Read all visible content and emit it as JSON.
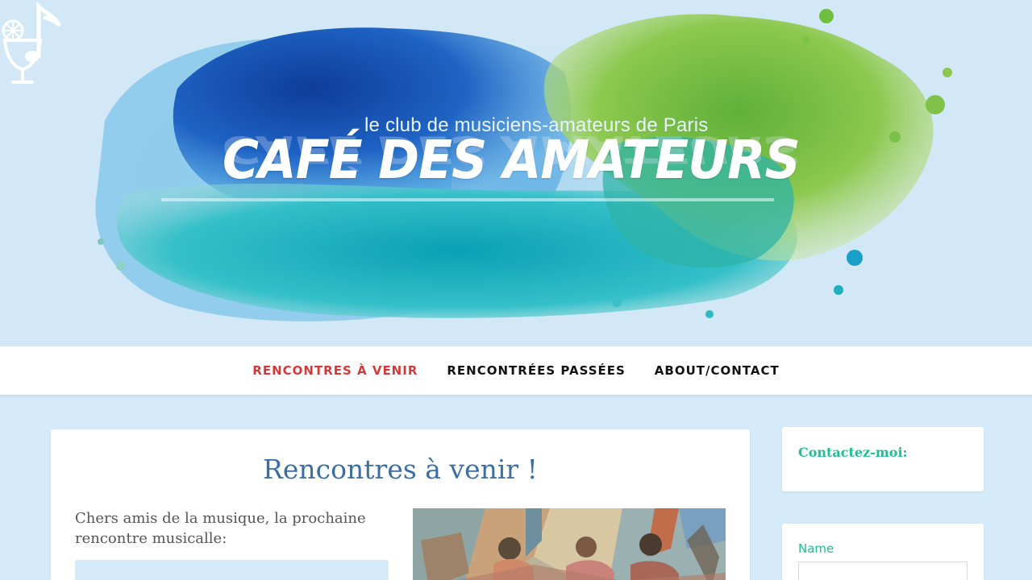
{
  "header": {
    "tagline": "le club de musiciens-amateurs de Paris",
    "brand": "CAFÉ DES AMATEURS",
    "logo_icon": "cocktail-music-note-icon",
    "colors": {
      "sky": "#d3e8f6",
      "deep_blue": "#1d4fa8",
      "teal": "#1aa6b8",
      "green": "#7ec24a"
    }
  },
  "nav": {
    "items": [
      {
        "label": "RENCONTRES À VENIR",
        "active": true
      },
      {
        "label": "RENCONTRÉES PASSÉES",
        "active": false
      },
      {
        "label": "ABOUT/CONTACT",
        "active": false
      }
    ],
    "active_color": "#d23a3a"
  },
  "main": {
    "title": "Rencontres à venir !",
    "intro": "Chers amis de la musique, la prochaine rencontre musicalle:",
    "image": "cubist-painting-figures"
  },
  "sidebar": {
    "contact_heading": "Contactez-moi:",
    "form": {
      "name_label": "Name",
      "name_value": ""
    },
    "accent": "#1fbf8f"
  }
}
